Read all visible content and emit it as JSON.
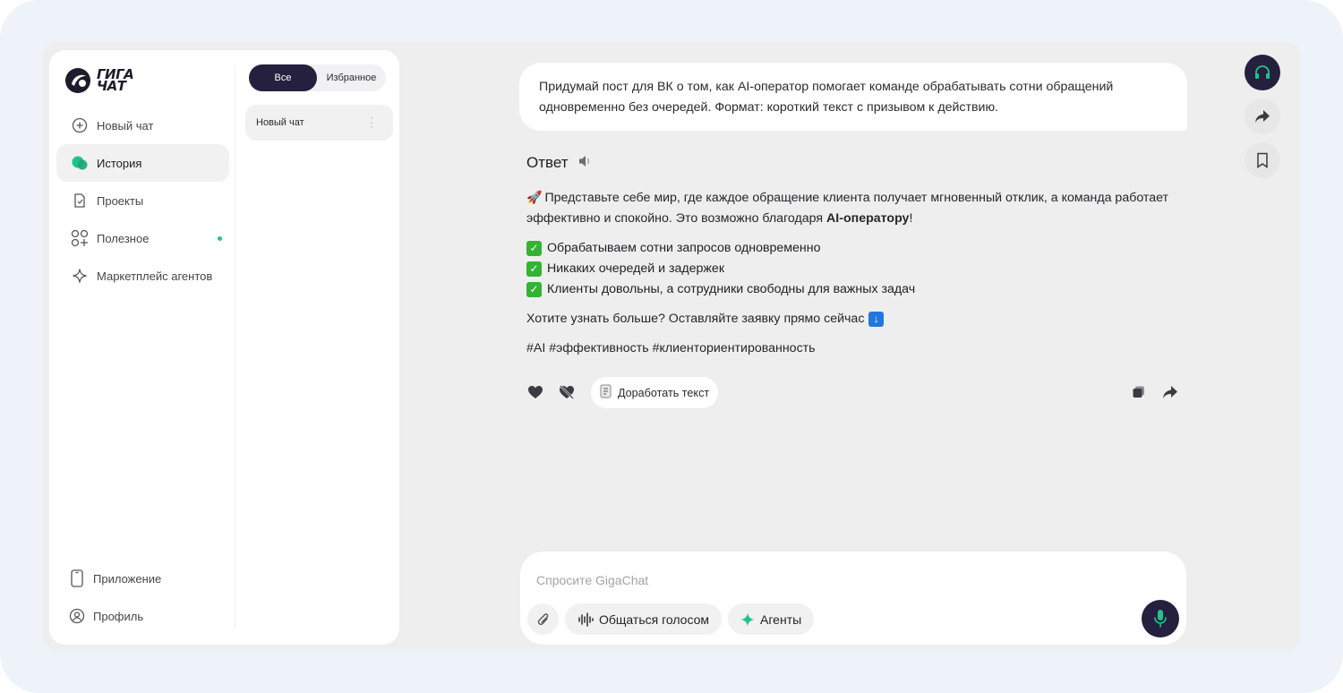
{
  "app": {
    "logo_line1": "ГИГА",
    "logo_line2": "ЧАТ"
  },
  "sidebar": {
    "nav": [
      {
        "label": "Новый чат",
        "icon": "plus-circle-icon"
      },
      {
        "label": "История",
        "icon": "chat-bubbles-icon"
      },
      {
        "label": "Проекты",
        "icon": "project-file-icon"
      },
      {
        "label": "Полезное",
        "icon": "grid-plus-icon"
      },
      {
        "label": "Маркетплейс агентов",
        "icon": "sparkle-icon"
      }
    ],
    "bottom": [
      {
        "label": "Приложение",
        "icon": "phone-icon"
      },
      {
        "label": "Профиль",
        "icon": "profile-icon"
      }
    ],
    "filters": {
      "all": "Все",
      "favorites": "Избранное"
    },
    "chats": [
      {
        "title": "Новый чат"
      }
    ]
  },
  "conversation": {
    "prompt": "Придумай пост для ВК о том, как AI-оператор помогает команде обрабатывать сотни обращений одновременно без очередей. Формат: короткий текст с призывом к действию.",
    "answer_title": "Ответ",
    "intro_text": "Представьте себе мир, где каждое обращение клиента получает мгновенный отклик, а команда работает эффективно и спокойно. Это возможно благодаря ",
    "intro_bold": "AI-оператору",
    "intro_end": "!",
    "bullets": [
      "Обрабатываем сотни запросов одновременно",
      "Никаких очередей и задержек",
      "Клиенты довольны, а сотрудники свободны для важных задач"
    ],
    "cta": "Хотите узнать больше? Оставляйте заявку прямо сейчас",
    "tags": "#AI #эффективность #клиенториентированность",
    "improve_label": "Доработать текст"
  },
  "composer": {
    "placeholder": "Спросите GigaChat",
    "voice_label": "Общаться голосом",
    "agents_label": "Агенты"
  },
  "colors": {
    "accent_dark": "#26203f",
    "green": "#20c58b",
    "check_green": "#34b233"
  }
}
